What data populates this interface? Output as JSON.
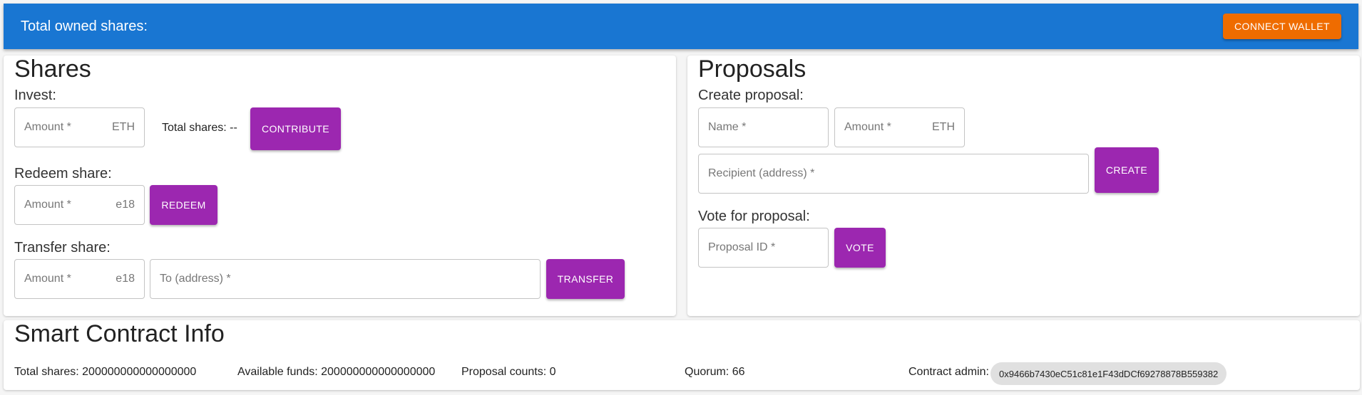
{
  "appbar": {
    "title": "Total owned shares:",
    "connect_label": "CONNECT WALLET"
  },
  "shares": {
    "title": "Shares",
    "invest": {
      "label": "Invest:",
      "amount_placeholder": "Amount *",
      "unit": "ETH",
      "total_shares": "Total shares: --",
      "button": "CONTRIBUTE"
    },
    "redeem": {
      "label": "Redeem share:",
      "amount_placeholder": "Amount *",
      "unit": "e18",
      "button": "REDEEM"
    },
    "transfer": {
      "label": "Transfer share:",
      "amount_placeholder": "Amount *",
      "unit": "e18",
      "to_placeholder": "To (address) *",
      "button": "TRANSFER"
    }
  },
  "proposals": {
    "title": "Proposals",
    "create": {
      "label": "Create proposal:",
      "name_placeholder": "Name *",
      "amount_placeholder": "Amount *",
      "unit": "ETH",
      "recipient_placeholder": "Recipient (address) *",
      "button": "CREATE"
    },
    "vote": {
      "label": "Vote for proposal:",
      "id_placeholder": "Proposal ID *",
      "button": "VOTE"
    }
  },
  "info": {
    "title": "Smart Contract Info",
    "total_shares": "Total shares: 200000000000000000",
    "available_funds": "Available funds: 200000000000000000",
    "proposal_counts": "Proposal counts: 0",
    "quorum": "Quorum: 66",
    "admin_label": "Contract admin:",
    "admin_address": "0x9466b7430eC51c81e1F43dDCf69278878B559382"
  },
  "colors": {
    "appbar": "#1976d2",
    "connect": "#ef6c00",
    "action": "#9c27b0"
  }
}
